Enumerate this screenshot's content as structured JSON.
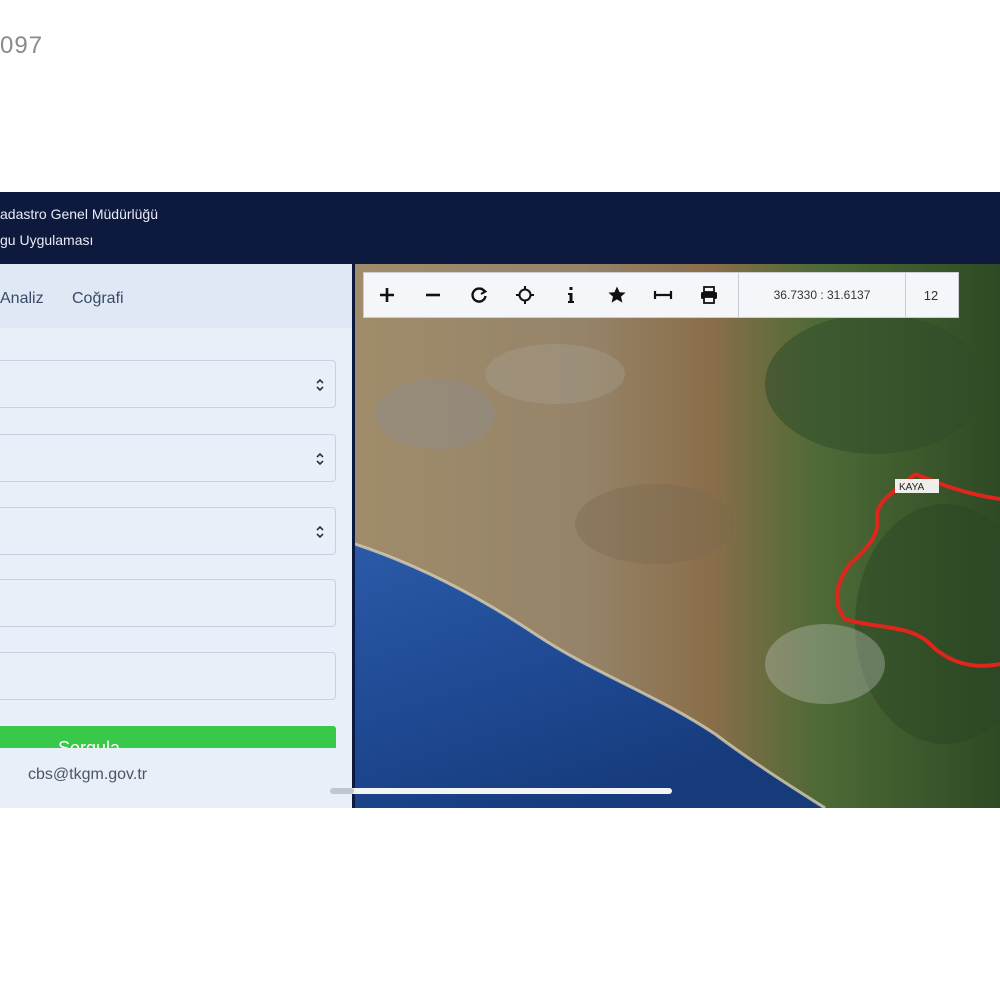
{
  "corner_text": "097",
  "header": {
    "line1": "adastro Genel Müdürlüğü",
    "line2": "gu Uygulaması"
  },
  "tabs": [
    {
      "label": "Analiz"
    },
    {
      "label": "Coğrafi"
    }
  ],
  "submit_label": "Sorgula",
  "footer_email": "cbs@tkgm.gov.tr",
  "toolbar": {
    "coordinates": "36.7330 : 31.6137",
    "zoom_level": "12"
  },
  "map_label": "KAYA",
  "colors": {
    "header_bg": "#0e1a3d",
    "submit_green": "#38c94a",
    "route_red": "#e0261c"
  }
}
